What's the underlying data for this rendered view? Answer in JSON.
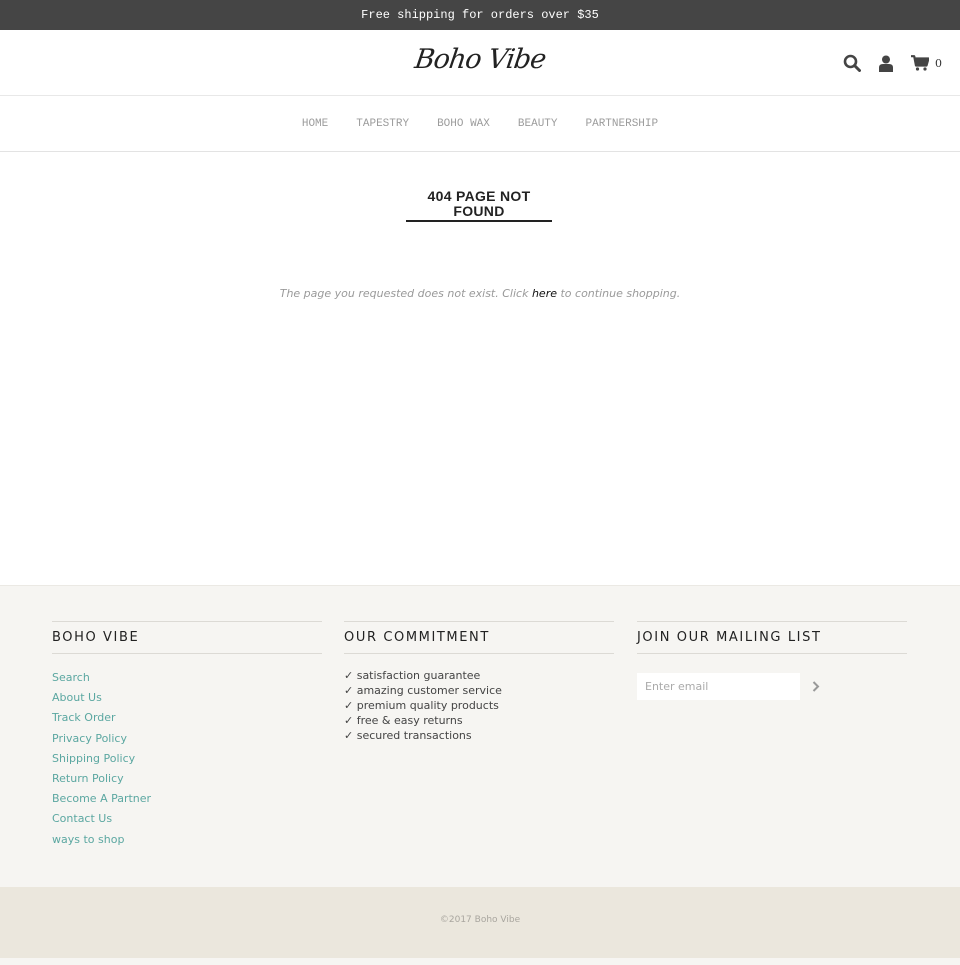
{
  "announcement": {
    "text": "Free shipping for orders over $35"
  },
  "header": {
    "logo": "Boho Vibe",
    "icons": [
      {
        "name": "search-icon"
      },
      {
        "name": "user-icon"
      },
      {
        "name": "cart-icon"
      }
    ],
    "cart_count": "0"
  },
  "nav": {
    "items": [
      {
        "label": "HOME"
      },
      {
        "label": "TAPESTRY"
      },
      {
        "label": "BOHO WAX"
      },
      {
        "label": "BEAUTY"
      },
      {
        "label": "PARTNERSHIP"
      }
    ]
  },
  "main": {
    "title": "404 PAGE NOT FOUND",
    "message_before": "The page you requested does not exist. Click ",
    "message_link": "here",
    "message_after": " to continue shopping."
  },
  "footer": {
    "col1": {
      "heading": "BOHO VIBE",
      "links": [
        "Search",
        "About Us",
        "Track Order",
        "Privacy Policy",
        "Shipping Policy",
        "Return Policy",
        "Become A Partner",
        "Contact Us",
        "ways to shop"
      ]
    },
    "col2": {
      "heading": "OUR COMMITMENT",
      "items": [
        "✓ satisfaction guarantee",
        "✓ amazing customer service",
        "✓ premium quality products",
        "✓ free & easy returns",
        "✓ secured transactions"
      ]
    },
    "col3": {
      "heading": "JOIN OUR MAILING LIST",
      "email_placeholder": "Enter email",
      "email_value": ""
    },
    "copyright": "©2017 Boho Vibe"
  },
  "colors": {
    "announcement_bg": "#454545",
    "link_accent": "#5ba7a1",
    "footer_bg": "#f6f5f2",
    "copyright_bg": "#ebe7dd"
  }
}
